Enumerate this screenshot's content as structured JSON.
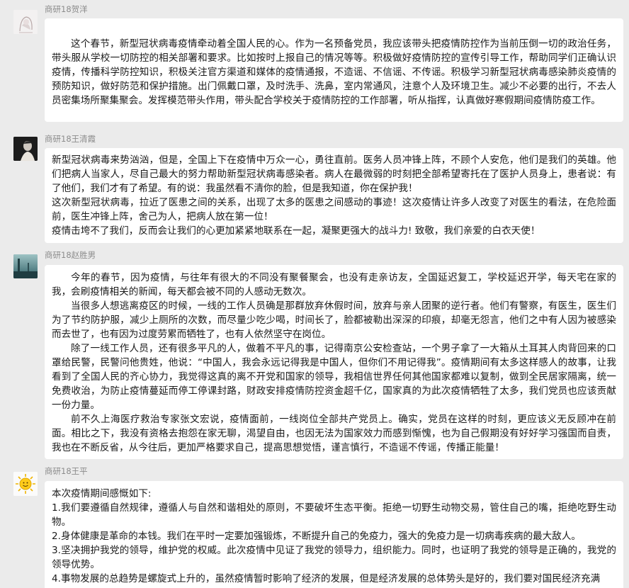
{
  "messages": [
    {
      "sender": "商研18贺洋",
      "paragraphs": [
        "这个春节，新型冠状病毒疫情牵动着全国人民的心。作为一名预备党员，我应该带头把疫情防控作为当前压倒一切的政治任务，带头服从学校一切防控的相关部署和要求。比如按时上报自己的情况等等。积极做好疫情防控的宣传引导工作，帮助同学们正确认识疫情，传播科学防控知识，积极关注官方渠道和媒体的疫情通报，不造谣、不信谣、不传谣。积极学习新型冠状病毒感染肺炎疫情的预防知识，做好防范和保护措施。出门佩戴口罩，及时洗手、洗鼻，室内常通风，注意个人及环境卫生。减少不必要的出行，不去人员密集场所聚集聚会。发挥模范带头作用，带头配合学校关于疫情防控的工作部署，听从指挥，认真做好寒假期间疫情防疫工作。"
      ]
    },
    {
      "sender": "商研18王清霞",
      "paragraphs": [
        "新型冠状病毒来势汹汹，但是，全国上下在疫情中万众一心，勇往直前。医务人员冲锋上阵，不顾个人安危，他们是我们的英雄。他们把病人当家人，尽自己最大的努力帮助新型冠状病毒感染者。病人在最微弱的时刻把全部希望寄托在了医护人员身上，患者说：有了他们，我们才有了希望。有的说：我虽然看不清你的脸，但是我知道，你在保护我！",
        "这次新型冠状病毒，拉近了医患之间的关系，出现了太多的医患之间感动的事迹！这次疫情让许多人改变了对医生的看法，在危险面前，医生冲锋上阵，舍己为人，把病人放在第一位！",
        "疫情击垮不了我们，反而会让我们的心更加紧紧地联系在一起，凝聚更强大的战斗力! 致敬，我们亲爱的白衣天使！"
      ]
    },
    {
      "sender": "商研18赵胜男",
      "paragraphs": [
        "今年的春节，因为疫情，与往年有很大的不同没有聚餐聚会，也没有走亲访友，全国延迟复工，学校延迟开学，每天宅在家的我，会刷疫情相关的新闻，每天都会被不同的人感动无数次。",
        "当很多人想逃离疫区的时候，一线的工作人员确是那群放弃休假时间，放弃与亲人团聚的逆行者。他们有警察，有医生，医生们为了节约防护服，减少上厕所的次数，而尽量少吃少喝，时间长了，脸都被勒出深深的印痕，却毫无怨言，他们之中有人因为被感染而去世了，也有因为过度劳累而牺牲了，也有人依然坚守在岗位。",
        "除了一线工作人员，还有很多平凡的人，做着不平凡的事，记得南京公安检查站，一个男子拿了一大箱从土耳其人肉背回来的口罩给民警，民警问他贵姓，他说：“中国人，我会永远记得我是中国人，但你们不用记得我”。疫情期间有太多这样感人的故事，让我看到了全国人民的齐心协力，我觉得这真的离不开党和国家的领导，我相信世界任何其他国家都难以复制，做到全民居家隔离，统一免费收治，为防止疫情蔓延而停工停课封路，财政安排疫情防控资金超千亿，国家真的为此次疫情牺牲了太多，我们党员也应该贡献一份力量。",
        "前不久上海医疗救治专家张文宏说，疫情面前，一线岗位全部共产党员上。确实，党员在这样的时刻，更应该义无反顾冲在前面。相比之下，我没有资格去抱怨在家无聊，渴望自由，也因无法为国家效力而感到惭愧，也为自己假期没有好好学习强国而自责，我也在不断反省，从今往后，更加严格要求自己，提高思想觉悟，谨言慎行，不造谣不传谣，传播正能量！"
      ]
    },
    {
      "sender": "商研18王平",
      "paragraphs": [
        "本次疫情期间感慨如下:",
        "1.我们要遵循自然规律，遵循人与自然和谐相处的原则，不要破坏生态平衡。拒绝一切野生动物交易，管住自己的嘴，拒绝吃野生动物。",
        "2.身体健康是革命的本钱。我们在平时一定要加强锻炼，不断提升自己的免疫力，强大的免疫力是一切病毒疾病的最大敌人。",
        "3.坚决拥护我党的领导，维护党的权威。此次疫情中见证了我党的领导力，组织能力。同时，也证明了我党的领导是正确的，我党的领导优势。",
        "4.事物发展的总趋势是螺旋式上升的，虽然疫情暂时影响了经济的发展，但是经济发展的总体势头是好的，我们要对国民经济充满"
      ]
    }
  ],
  "colors": {
    "background": "#ebebeb",
    "bubble": "#ffffff",
    "sender_name": "#8c8c8c",
    "text": "#1a1a1a"
  },
  "icons": [
    "avatar-girl-sketch",
    "avatar-dark-portrait",
    "avatar-teal-landscape",
    "avatar-sun-emoji"
  ]
}
